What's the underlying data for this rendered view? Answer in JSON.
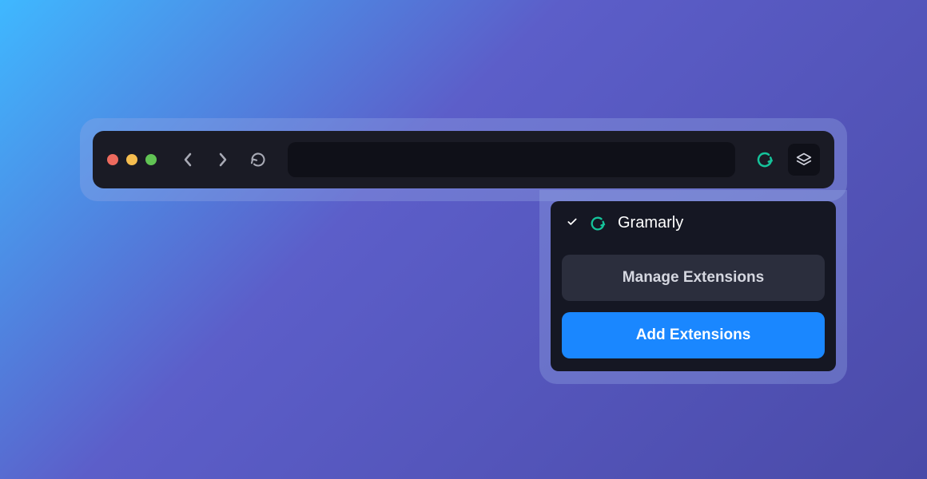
{
  "popup": {
    "extension_name": "Gramarly",
    "manage_label": "Manage Extensions",
    "add_label": "Add Extensions"
  },
  "colors": {
    "grammarly_green": "#15c39a",
    "accent_blue": "#1a87ff"
  }
}
